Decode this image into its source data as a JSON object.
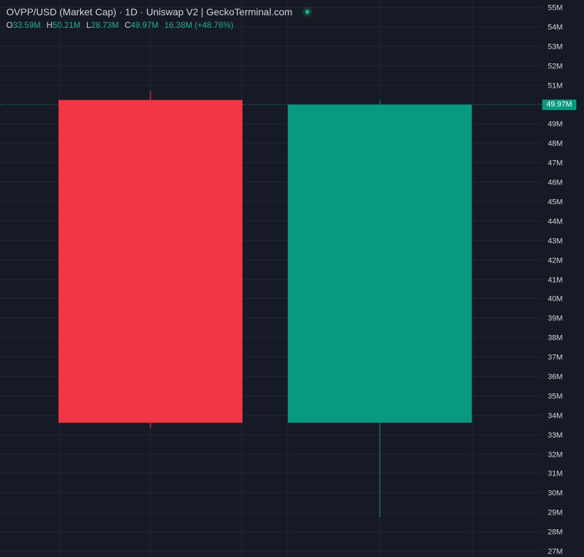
{
  "header": {
    "title": "OVPP/USD (Market Cap) · 1D · Uniswap V2 | GeckoTerminal.com",
    "ohlc": {
      "o_label": "O",
      "o_value": "33.59M",
      "h_label": "H",
      "h_value": "50.21M",
      "l_label": "L",
      "l_value": "28.73M",
      "c_label": "C",
      "c_value": "49.97M",
      "change": "16.38M (+48.76%)"
    }
  },
  "price_tag": "49.97M",
  "colors": {
    "background": "#161a25",
    "grid": "#232734",
    "up": "#089981",
    "down": "#f23645",
    "text": "#d1d4dc"
  },
  "chart_data": {
    "type": "candlestick",
    "title": "OVPP/USD (Market Cap) · 1D · Uniswap V2 | GeckoTerminal.com",
    "ylim": [
      27,
      55
    ],
    "y_unit": "M",
    "y_ticks": [
      "55M",
      "54M",
      "53M",
      "52M",
      "51M",
      "50M",
      "49M",
      "48M",
      "47M",
      "46M",
      "45M",
      "44M",
      "43M",
      "42M",
      "41M",
      "40M",
      "39M",
      "38M",
      "37M",
      "36M",
      "35M",
      "34M",
      "33M",
      "32M",
      "31M",
      "30M",
      "29M",
      "28M",
      "27M"
    ],
    "candles": [
      {
        "open": 50.21,
        "high": 50.7,
        "low": 33.3,
        "close": 33.59
      },
      {
        "open": 33.59,
        "high": 50.21,
        "low": 28.73,
        "close": 49.97
      }
    ],
    "last_price": 49.97,
    "grid": true
  }
}
